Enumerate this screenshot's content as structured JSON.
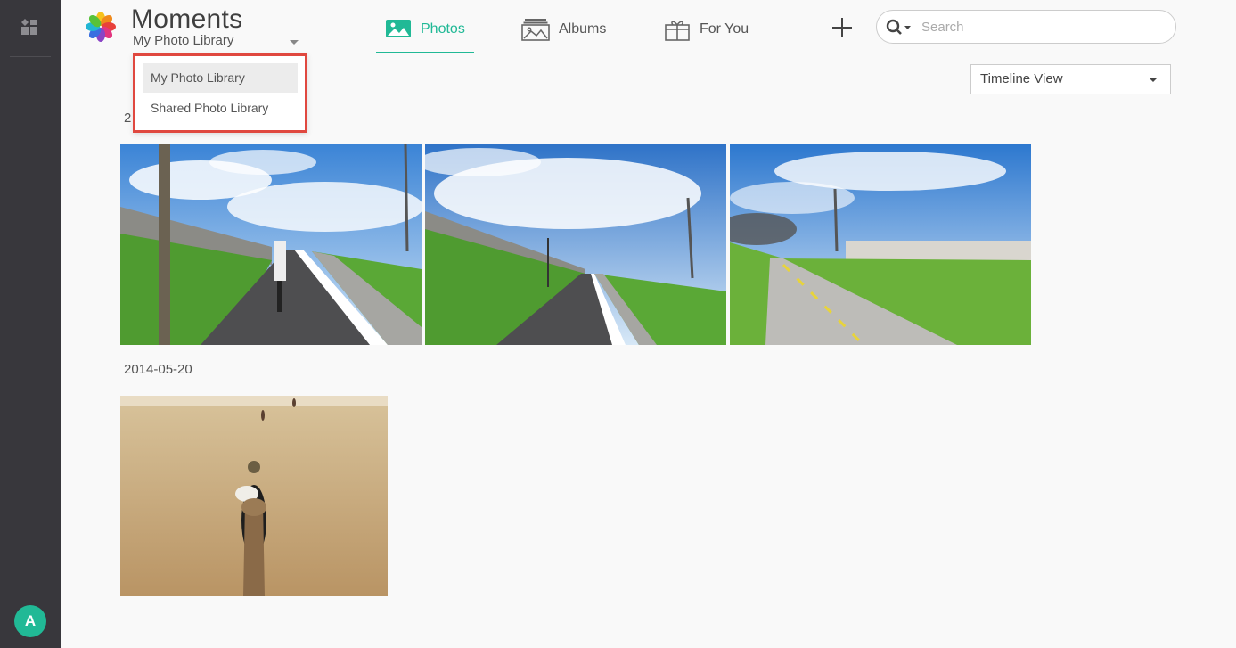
{
  "app": {
    "title": "Moments"
  },
  "library": {
    "selected": "My Photo Library",
    "options": [
      "My Photo Library",
      "Shared Photo Library"
    ]
  },
  "tabs": [
    {
      "label": "Photos",
      "icon": "image-icon",
      "active": true
    },
    {
      "label": "Albums",
      "icon": "albums-icon",
      "active": false
    },
    {
      "label": "For You",
      "icon": "gift-icon",
      "active": false
    }
  ],
  "search": {
    "placeholder": "Search"
  },
  "view": {
    "selected": "Timeline View"
  },
  "groups": [
    {
      "date": "2",
      "photos": [
        "riverside-path-photo",
        "riverside-path-photo",
        "bike-lane-photo"
      ]
    },
    {
      "date": "2014-05-20",
      "photos": [
        "desert-camel-photo"
      ]
    }
  ],
  "user": {
    "initial": "A"
  },
  "colors": {
    "accent": "#21b996",
    "rail": "#38373c",
    "highlight": "#e0483f"
  }
}
